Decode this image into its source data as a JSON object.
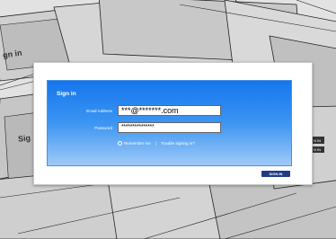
{
  "background": {
    "sign_in_text_1": "gn in",
    "sign_in_text_2": "Sig",
    "right_fragment_1": "N IN",
    "right_fragment_2": "N IN"
  },
  "dialog": {
    "title": "Sign in",
    "email_label": "Email Address",
    "email_value": "***@*******.com",
    "password_label": "Password",
    "password_value": "***************",
    "remember_label": "Remember me",
    "separator": "|",
    "trouble_link": "Trouble signing in?",
    "signin_button": "SIGN IN"
  },
  "colors": {
    "panel_top": "#1576ee",
    "panel_bottom": "#9fcaf8",
    "button": "#1f3c86"
  }
}
